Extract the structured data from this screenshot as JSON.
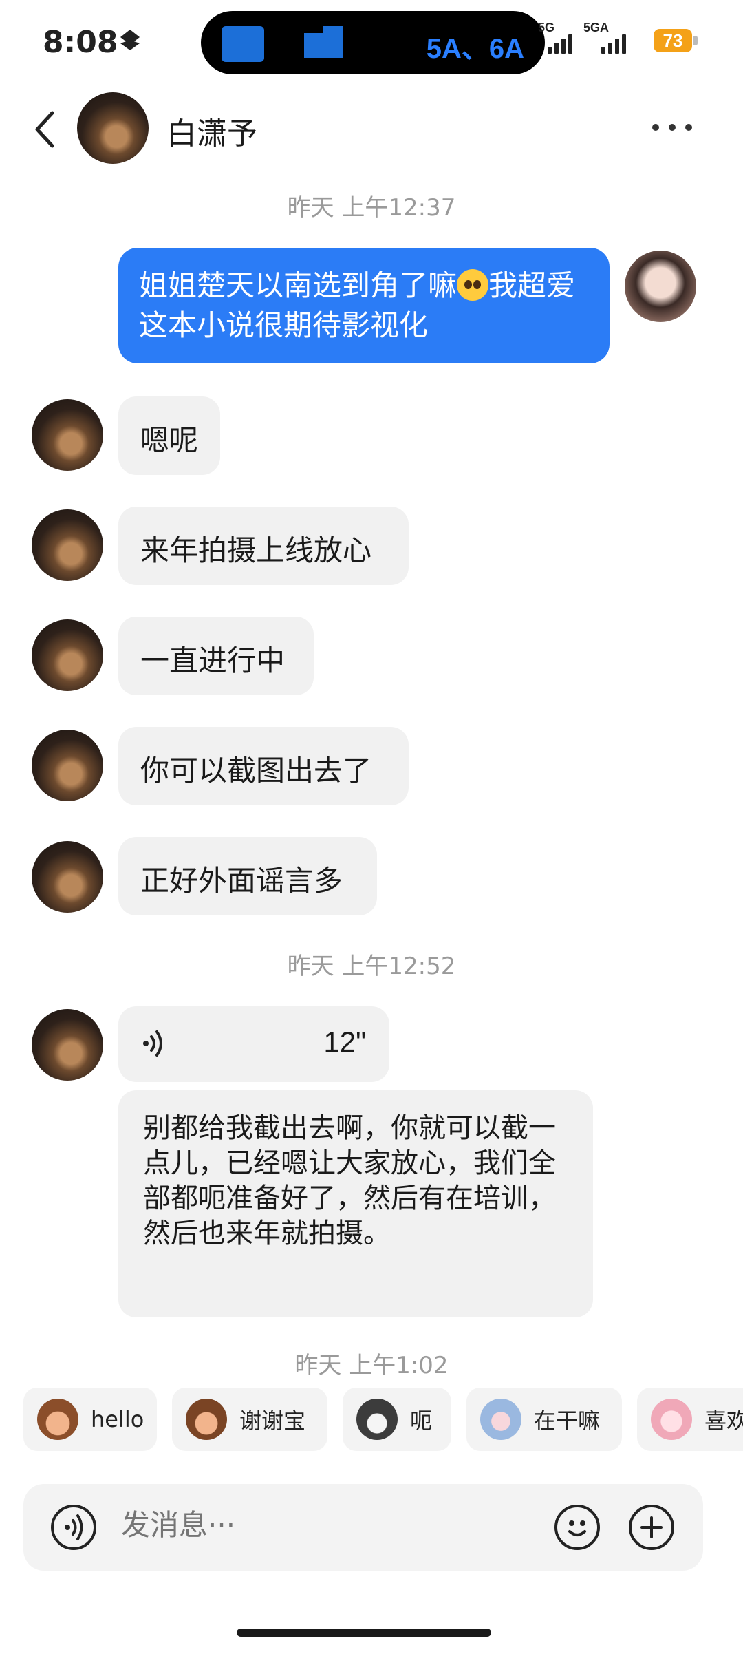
{
  "status_bar": {
    "time": "8:08",
    "island_text": "5A、6A",
    "signal1_label": "5G",
    "signal2_label": "5GA",
    "battery": "73",
    "battery_color": "#f4a118"
  },
  "header": {
    "contact_name": "白潇予"
  },
  "messages": {
    "time1": "昨天 上午12:37",
    "out1_text": "姐姐楚天以南选到角了嘛",
    "out1_text2": "我超爱这本小说很期待影视化",
    "in1": "嗯呢",
    "in2": "来年拍摄上线放心",
    "in3": "一直进行中",
    "in4": "你可以截图出去了",
    "in5": "正好外面谣言多",
    "time2": "昨天 上午12:52",
    "voice_duration": "12\"",
    "voice_transcript": "别都给我截出去啊，你就可以截一点儿，已经嗯让大家放心，我们全部都呃准备好了，然后有在培训，然后也来年就拍摄。",
    "time3": "昨天 上午1:02"
  },
  "quick_replies": [
    "hello",
    "谢谢宝",
    "呃",
    "在干嘛",
    "喜欢"
  ],
  "input": {
    "placeholder": "发消息···"
  },
  "colors": {
    "outgoing_bubble": "#2b7cf6",
    "incoming_bubble": "#f1f1f1"
  }
}
